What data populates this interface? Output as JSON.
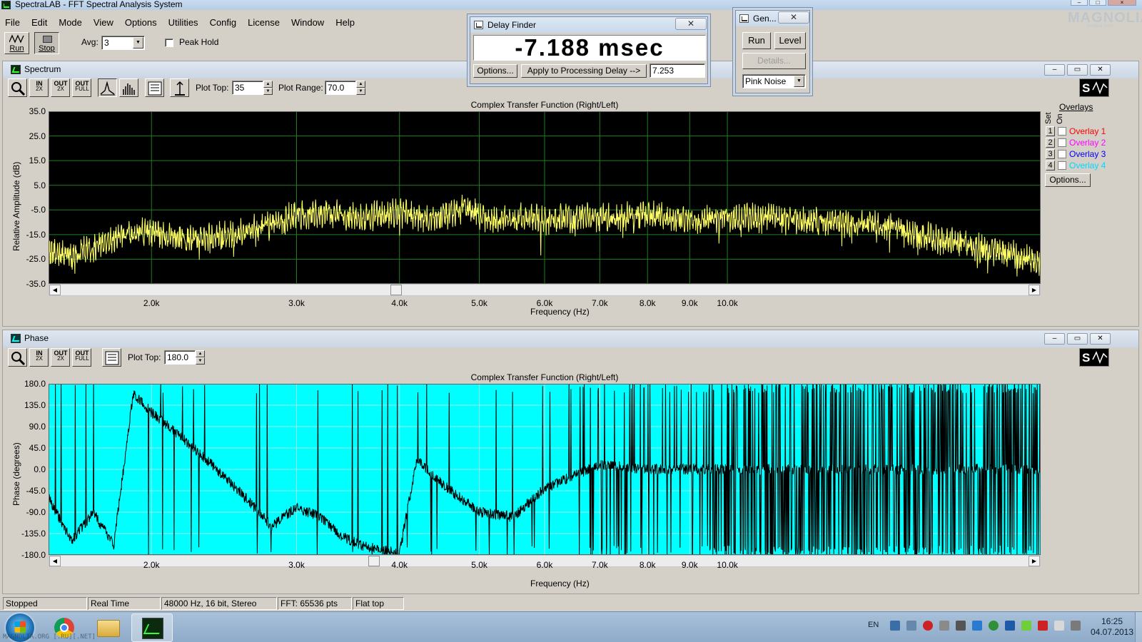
{
  "window": {
    "title": "SpectraLAB - FFT Spectral Analysis System"
  },
  "watermark": {
    "text": "MAGNOLIA",
    "sub": "Certified Team"
  },
  "menu": [
    "File",
    "Edit",
    "Mode",
    "View",
    "Options",
    "Utilities",
    "Config",
    "License",
    "Window",
    "Help"
  ],
  "toolbar": {
    "run_label": "Run",
    "stop_label": "Stop",
    "avg_label": "Avg:",
    "avg_value": "3",
    "peak_hold_label": "Peak Hold",
    "peak_hold_checked": false
  },
  "spectrum": {
    "window_title": "Spectrum",
    "plot_top_label": "Plot Top:",
    "plot_top": "35",
    "plot_range_label": "Plot Range:",
    "plot_range": "70.0",
    "zoom_buttons": [
      {
        "top": "IN",
        "bottom": "2X"
      },
      {
        "top": "OUT",
        "bottom": "2X"
      },
      {
        "top": "OUT",
        "bottom": "FULL"
      }
    ],
    "overlays": {
      "header": "Overlays",
      "col_set": "Set",
      "col_on": "On",
      "items": [
        {
          "num": "1",
          "name": "Overlay 1",
          "color": "#ff0000"
        },
        {
          "num": "2",
          "name": "Overlay 2",
          "color": "#ff00ff"
        },
        {
          "num": "3",
          "name": "Overlay 3",
          "color": "#0000ff"
        },
        {
          "num": "4",
          "name": "Overlay 4",
          "color": "#00ffff"
        }
      ],
      "options_label": "Options..."
    }
  },
  "phase": {
    "window_title": "Phase",
    "plot_top_label": "Plot Top:",
    "plot_top": "180.0"
  },
  "delay_finder": {
    "title": "Delay Finder",
    "readout": "-7.188 msec",
    "options_label": "Options...",
    "apply_label": "Apply to Processing Delay -->",
    "delay_value": "7.253"
  },
  "generator": {
    "title": "Gen...",
    "run_label": "Run",
    "level_label": "Level",
    "details_label": "Details...",
    "signal": "Pink Noise"
  },
  "status": {
    "state": "Stopped",
    "mode": "Real Time",
    "format": "48000 Hz, 16 bit, Stereo",
    "fft": "FFT: 65536 pts",
    "window": "Flat top"
  },
  "taskbar": {
    "language": "EN",
    "time": "16:25",
    "date": "04.07.2013",
    "caption": "MAGNOLIA.ORG [.RU][.NET]"
  },
  "chart_data": [
    {
      "type": "line",
      "title": "Complex Transfer Function (Right/Left)",
      "xlabel": "Frequency (Hz)",
      "ylabel": "Relative Amplitude (dB)",
      "x_scale": "log",
      "xlim": [
        1500,
        24000
      ],
      "ylim": [
        -35,
        35
      ],
      "yticks": [
        "35.0",
        "25.0",
        "15.0",
        "5.0",
        "-5.0",
        "-15.0",
        "-25.0",
        "-35.0"
      ],
      "xticks": [
        "2.0k",
        "3.0k",
        "4.0k",
        "5.0k",
        "6.0k",
        "7.0k",
        "8.0k",
        "9.0k",
        "10.0k"
      ],
      "background": "#000000",
      "grid_color": "#1f7f1f",
      "trace_color": "#ffff66",
      "series": [
        {
          "x": [
            1500,
            1600,
            1700,
            1800,
            2000,
            2200,
            2500,
            2800,
            3000,
            3300,
            3600,
            4000,
            4400,
            4800,
            5200,
            5600,
            6000,
            7000,
            8000,
            9000,
            10000,
            12000,
            14000,
            16000,
            18000,
            20000,
            22000,
            24000
          ],
          "values": [
            -22,
            -24,
            -20,
            -16,
            -14,
            -17,
            -15,
            -11,
            -7,
            -6,
            -8,
            -6,
            -9,
            -4,
            -10,
            -8,
            -9,
            -8,
            -7,
            -9,
            -8,
            -9,
            -10,
            -12,
            -17,
            -20,
            -23,
            -26
          ]
        }
      ]
    },
    {
      "type": "line",
      "title": "Complex Transfer Function (Right/Left)",
      "xlabel": "Frequency (Hz)",
      "ylabel": "Phase (degrees)",
      "x_scale": "log",
      "xlim": [
        1500,
        24000
      ],
      "ylim": [
        -180,
        180
      ],
      "yticks": [
        "180.0",
        "135.0",
        "90.0",
        "45.0",
        "0.0",
        "-45.0",
        "-90.0",
        "-135.0",
        "-180.0"
      ],
      "xticks": [
        "2.0k",
        "3.0k",
        "4.0k",
        "5.0k",
        "6.0k",
        "7.0k",
        "8.0k",
        "9.0k",
        "10.0k"
      ],
      "background": "#00ffff",
      "grid_color": "#9fe8e8",
      "trace_color": "#000000",
      "series": [
        {
          "x": [
            1500,
            1600,
            1700,
            1800,
            1900,
            2000,
            2200,
            2400,
            2600,
            2800,
            3000,
            3200,
            3400,
            3600,
            3800,
            4000,
            4200,
            4500,
            5000,
            5500,
            6000,
            7000,
            8000,
            10000,
            13000,
            17000,
            24000
          ],
          "values": [
            -60,
            -150,
            -90,
            -160,
            160,
            120,
            60,
            0,
            -60,
            -120,
            -80,
            -100,
            -140,
            -160,
            -170,
            -175,
            20,
            -30,
            -90,
            -100,
            -40,
            10,
            0,
            0,
            0,
            0,
            0
          ]
        }
      ]
    }
  ]
}
